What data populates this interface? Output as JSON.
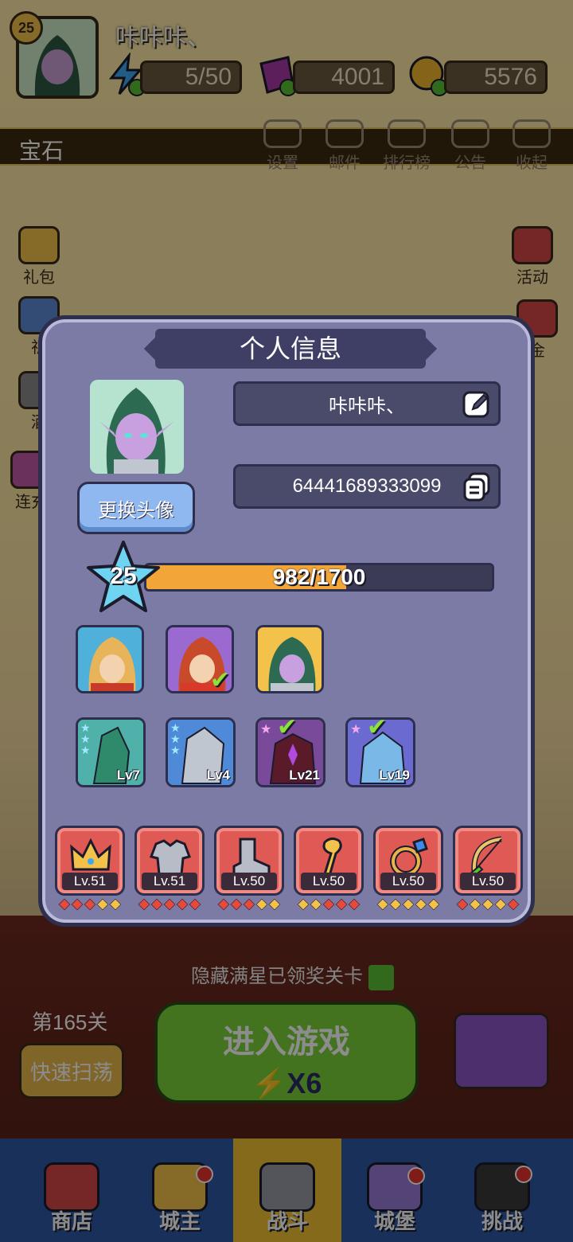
{
  "player": {
    "level": "25",
    "name": "咔咔咔、"
  },
  "resources": {
    "energy": "5/50",
    "gems": "4001",
    "coins": "5576"
  },
  "strip": {
    "label": "宝石"
  },
  "top_nav": [
    "设置",
    "邮件",
    "排行榜",
    "公告",
    "收起"
  ],
  "side_left": [
    "礼包",
    "祈",
    "酒",
    "连充"
  ],
  "side_right": [
    "活动",
    "金"
  ],
  "modal": {
    "title": "个人信息",
    "name_field": "咔咔咔、",
    "id_field": "64441689333099",
    "change_avatar": "更换头像",
    "level": "25",
    "xp_text": "982/1700",
    "xp_current": 982,
    "xp_max": 1700,
    "pets": [
      {
        "level": "Lv7",
        "stars": 3
      },
      {
        "level": "Lv4",
        "stars": 3
      },
      {
        "level": "Lv21",
        "stars": 1
      },
      {
        "level": "Lv19",
        "stars": 1
      }
    ],
    "equipment": [
      {
        "name": "crown",
        "level": "Lv.51"
      },
      {
        "name": "armor",
        "level": "Lv.51"
      },
      {
        "name": "boots",
        "level": "Lv.50"
      },
      {
        "name": "staff",
        "level": "Lv.50"
      },
      {
        "name": "ring",
        "level": "Lv.50"
      },
      {
        "name": "bow",
        "level": "Lv.50"
      }
    ]
  },
  "below": {
    "hidden_stars": "隐藏满星已领奖关卡",
    "stage": "第165关",
    "sweep": "快速扫荡",
    "play": "进入游戏",
    "cost": "X6"
  },
  "tabs": [
    "商店",
    "城主",
    "战斗",
    "城堡",
    "挑战"
  ],
  "colors": {
    "accent": "#f3a638",
    "modal_bg": "#7b7ba6",
    "equip_red": "#e05a55"
  }
}
